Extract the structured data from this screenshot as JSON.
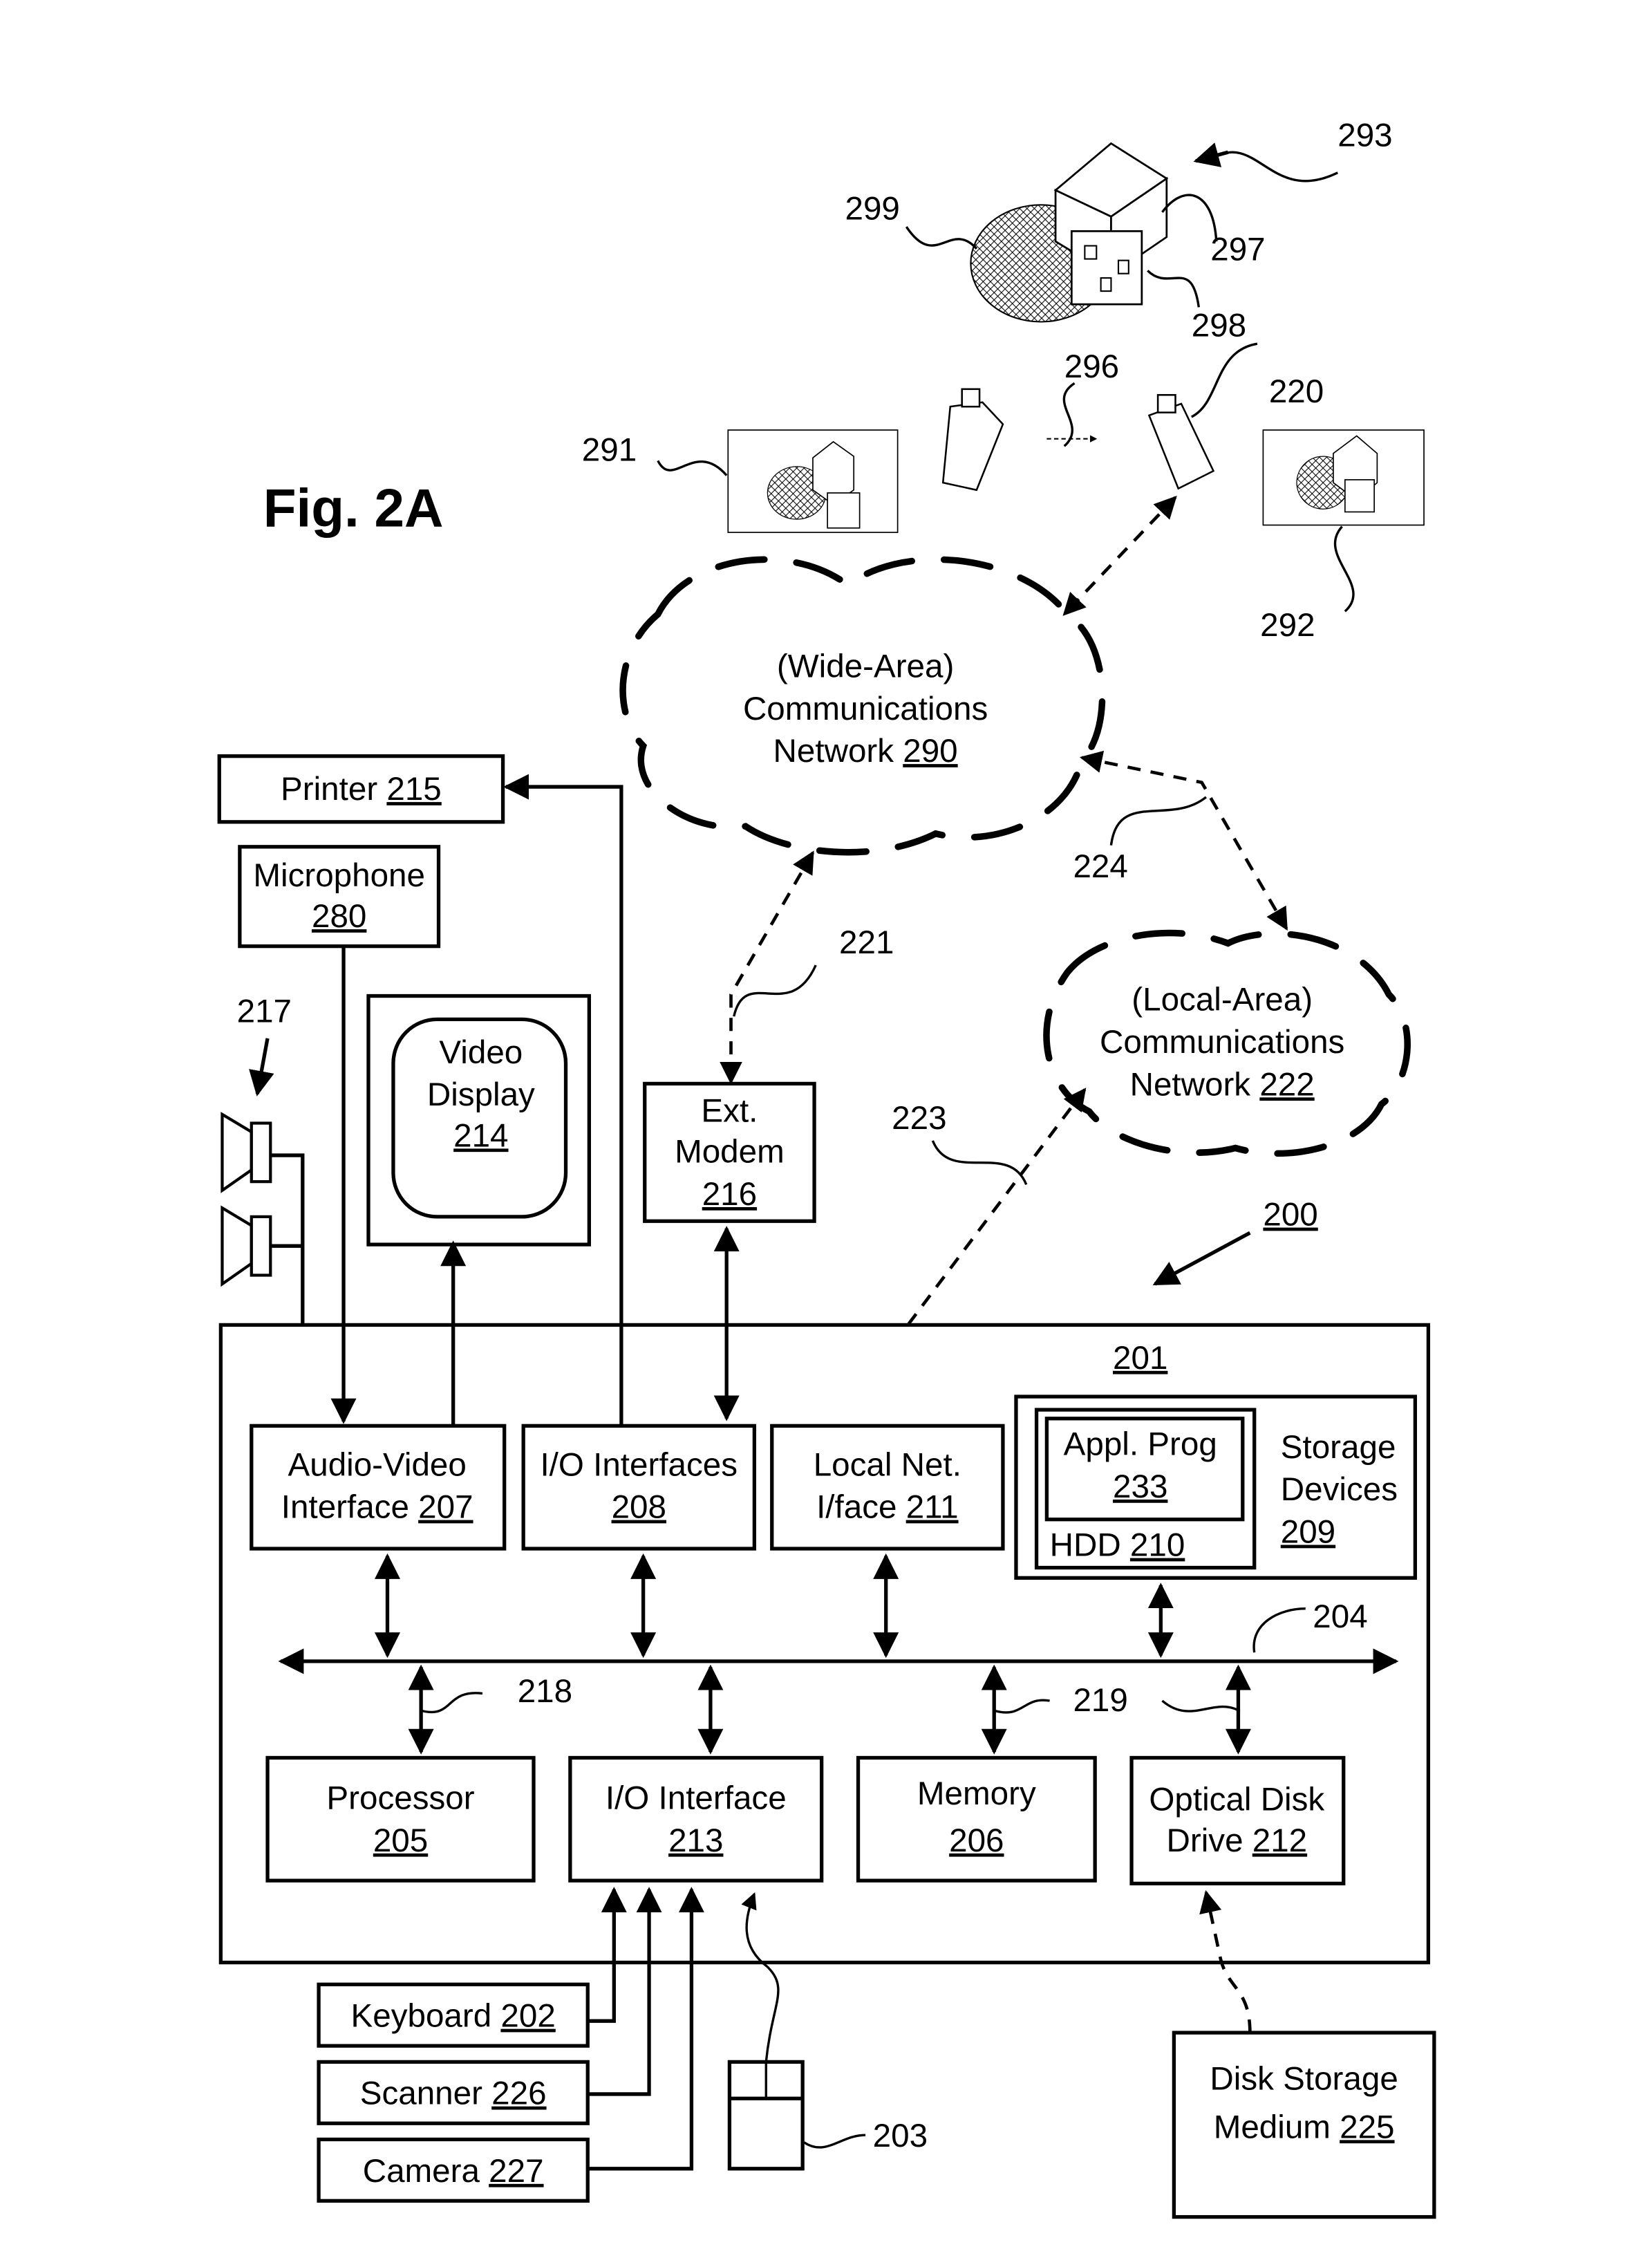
{
  "figure_title": "Fig. 2A",
  "scene": {
    "label_scene": "293",
    "label_sphere": "299",
    "label_cube": "297",
    "label_card": "298",
    "label_motion": "296",
    "label_camera": "220",
    "label_image_left": "291",
    "label_image_right": "292"
  },
  "networks": {
    "wan": {
      "line1": "(Wide-Area)",
      "line2": "Communications",
      "line3_text": "Network ",
      "line3_ref": "290"
    },
    "lan": {
      "line1": "(Local-Area)",
      "line2": "Communications",
      "line3_text": "Network ",
      "line3_ref": "222"
    },
    "link_wan_modem": "221",
    "link_lan_iface": "223",
    "link_wan_lan": "224"
  },
  "external": {
    "printer": {
      "text": "Printer ",
      "ref": "215"
    },
    "microphone": {
      "text": "Microphone",
      "ref": "280"
    },
    "speakers_ref": "217",
    "video_display": {
      "line1": "Video",
      "line2": "Display",
      "ref": "214"
    },
    "modem": {
      "line1": "Ext.",
      "line2": "Modem",
      "ref": "216"
    },
    "keyboard": {
      "text": "Keyboard ",
      "ref": "202"
    },
    "scanner": {
      "text": "Scanner ",
      "ref": "226"
    },
    "camera": {
      "text": "Camera ",
      "ref": "227"
    },
    "mouse_ref": "203",
    "disk_medium": {
      "line1": "Disk Storage",
      "line2_text": "Medium ",
      "ref": "225"
    }
  },
  "computer": {
    "system_ref": "200",
    "module_ref": "201",
    "av_interface": {
      "line1": "Audio-Video",
      "line2_text": "Interface ",
      "ref": "207"
    },
    "io_interfaces": {
      "line1": "I/O Interfaces",
      "ref": "208"
    },
    "local_net": {
      "line1": "Local Net.",
      "line2_text": "I/face ",
      "ref": "211"
    },
    "storage": {
      "line1": "Storage",
      "line2": "Devices",
      "ref": "209"
    },
    "appl_prog": {
      "line1": "Appl. Prog",
      "ref": "233"
    },
    "hdd": {
      "text": "HDD ",
      "ref": "210"
    },
    "bus_ref": "204",
    "bus_link_a": "218",
    "bus_link_b": "219",
    "processor": {
      "line1": "Processor",
      "ref": "205"
    },
    "io_interface": {
      "line1": "I/O Interface",
      "ref": "213"
    },
    "memory": {
      "line1": "Memory",
      "ref": "206"
    },
    "optical": {
      "line1": "Optical Disk",
      "line2_text": "Drive ",
      "ref": "212"
    }
  }
}
